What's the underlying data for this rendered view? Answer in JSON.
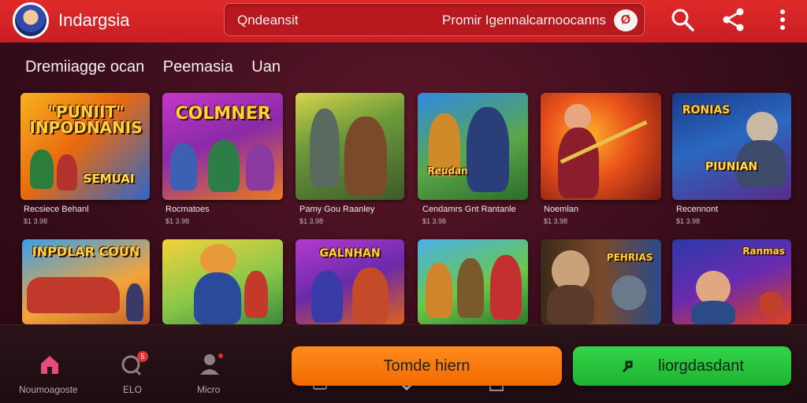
{
  "header": {
    "app_title": "Indargsia",
    "search_value": "Qndeansit",
    "search_right_text": "Promir Igennalcarnoocanns",
    "search_badge": "Ø"
  },
  "section": {
    "title_parts": [
      "Dremiiagge ocan",
      "Peemasia",
      "Uan"
    ]
  },
  "cards_row1": [
    {
      "banner": "“PUNIIT”\nINPODNANIS",
      "banner2": "SEMUAI",
      "caption": "Recsiece Behanl",
      "sub": "$1 3.98"
    },
    {
      "banner": "COLMNER",
      "banner2": "",
      "caption": "Rocmatoes",
      "sub": "$1 3.98"
    },
    {
      "banner": "",
      "banner2": "",
      "caption": "Pamy Gou Raanley",
      "sub": "$1 3.98"
    },
    {
      "banner": "",
      "banner2": "Reudan",
      "caption": "Cendamrs Gnt Rantanle",
      "sub": "$1 3.98"
    },
    {
      "banner": "",
      "banner2": "",
      "caption": "Noemlan",
      "sub": "$1 3.98"
    },
    {
      "banner": "RONIAS",
      "banner2": "PIUNIAN",
      "caption": "Recennont",
      "sub": "$1 3.98"
    }
  ],
  "cards_row2": [
    {
      "banner": "INPDLAR COUN"
    },
    {
      "banner": ""
    },
    {
      "banner": "GALNHAN"
    },
    {
      "banner": ""
    },
    {
      "banner": "PEHRIAS"
    },
    {
      "banner": "Ranmas"
    }
  ],
  "bottom_nav": [
    {
      "label": "Noumoagoste",
      "icon": "home-icon"
    },
    {
      "label": "ELO",
      "icon": "chat-icon",
      "badge": "5"
    },
    {
      "label": "Micro",
      "icon": "profile-icon"
    }
  ],
  "actions": {
    "primary": "Tomde hiern",
    "secondary": "liorgdasdant"
  },
  "colors": {
    "header": "#d62428",
    "primary_button": "#f47a0e",
    "secondary_button": "#27c43c",
    "background": "#3a0d1c"
  }
}
